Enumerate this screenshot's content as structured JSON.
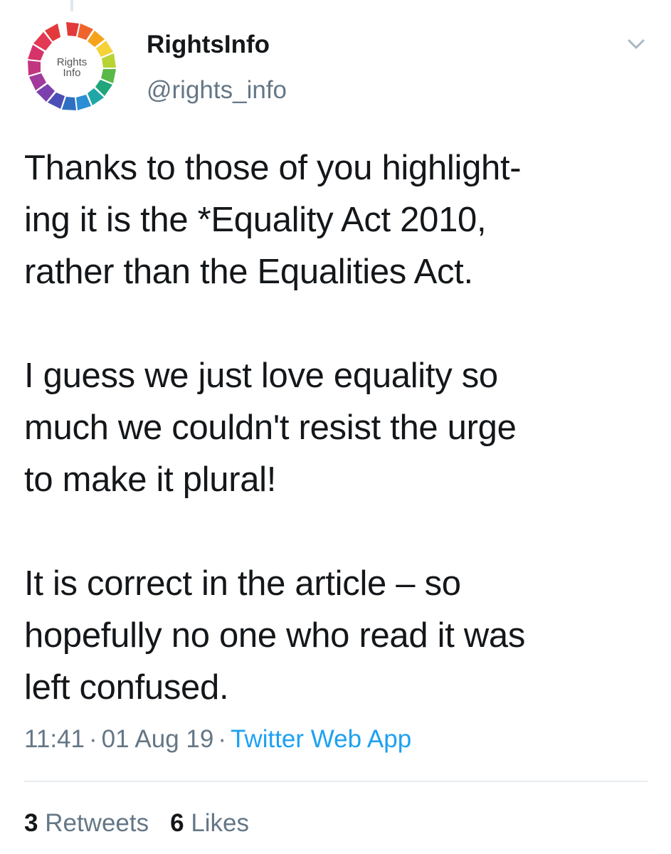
{
  "author": {
    "display_name": "RightsInfo",
    "handle": "@rights_info",
    "avatar_text_line1": "Rights",
    "avatar_text_line2": "Info"
  },
  "tweet": {
    "paragraphs": [
      "Thanks to those of you highlight-\ning it is the *Equality Act 2010,\nrather than the Equalities Act.",
      "I guess we just love equality so\nmuch we couldn't resist the urge\nto make it plural!",
      "It is correct in the article – so\nhopefully no one who read it was\nleft confused."
    ],
    "time": "11:41",
    "date": "01 Aug 19",
    "source": "Twitter Web App",
    "separator": "·"
  },
  "stats": {
    "retweets_count": "3",
    "retweets_label": "Retweets",
    "likes_count": "6",
    "likes_label": "Likes"
  },
  "icons": {
    "menu": "chevron-down-icon"
  },
  "colors": {
    "text": "#14171a",
    "secondary": "#657786",
    "link": "#1da1f2",
    "divider": "#e6ecf0"
  }
}
